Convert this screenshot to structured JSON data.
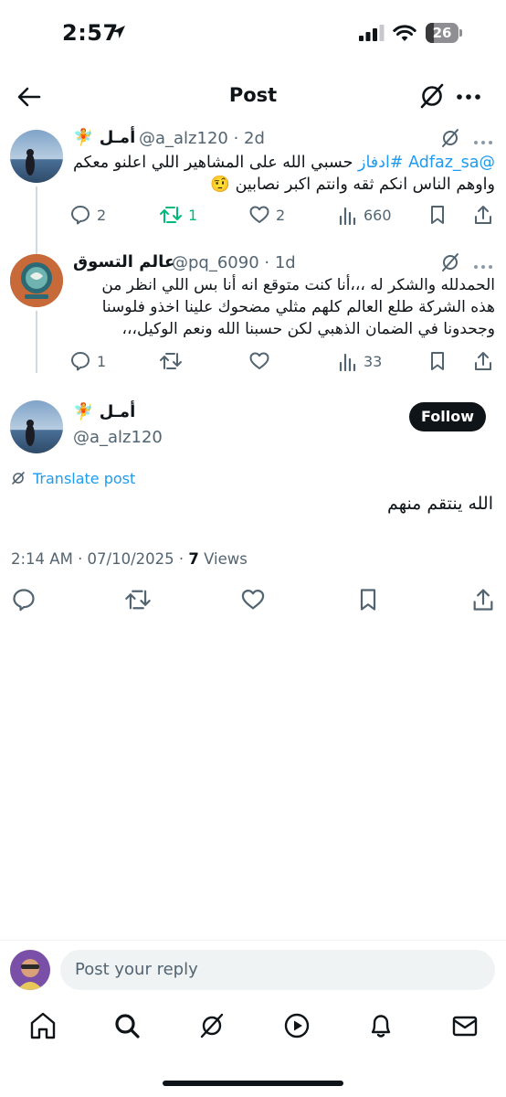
{
  "status_bar": {
    "time": "2:57",
    "battery": "26",
    "battery_level": 0.26
  },
  "header": {
    "title": "Post",
    "icons": [
      "arrow-left-icon",
      "grok-icon",
      "more-icon"
    ]
  },
  "thread": [
    {
      "name": "أمـل",
      "name_emoji": "🧚",
      "handle": "@a_alz120",
      "time": "2d",
      "text_mention": "@Adfaz_sa",
      "text_hashtag": "#ادفاز",
      "text_line1": "حسبي الله على المشاهير اللي اعلنو معكم",
      "text_line2": "واوهم الناس انكم ثقه وانتم اكبر نصابين",
      "text_emoji": "🤨",
      "stats": {
        "replies": "2",
        "reposts": "1",
        "likes": "2",
        "views": "660"
      }
    },
    {
      "name": "عالم التسوق",
      "handle": "@pq_6090",
      "time": "1d",
      "text_line1": "الحمدلله والشكر له ،،،أنا كنت متوقع انه أنا بس اللي انظر من",
      "text_line2": "هذه الشركة طلع العالم كلهم مثلي مضحوك علينا اخذو فلوسنا",
      "text_line3": "وجحدونا في الضمان الذهبي لكن حسبنا الله ونعم الوكيل،،،",
      "stats": {
        "replies": "1",
        "reposts": "",
        "likes": "",
        "views": "33"
      }
    }
  ],
  "main_post": {
    "name": "أمـل",
    "name_emoji": "🧚",
    "handle": "@a_alz120",
    "follow_label": "Follow",
    "translate_label": "Translate post",
    "text": "الله ينتقم منهم",
    "timestamp": "2:14 AM · 07/10/2025 · ",
    "views_count": "7",
    "views_label": " Views"
  },
  "reply_bar": {
    "placeholder": "Post your reply"
  },
  "bottom_nav": [
    "home-icon",
    "search-icon",
    "grok-icon",
    "video-icon",
    "notifications-icon",
    "messages-icon"
  ],
  "colors": {
    "accent": "#1d9bf0",
    "text": "#0f1419",
    "secondary": "#536471",
    "repost_green": "#00ba7c",
    "thread_line": "#cfd9de"
  }
}
